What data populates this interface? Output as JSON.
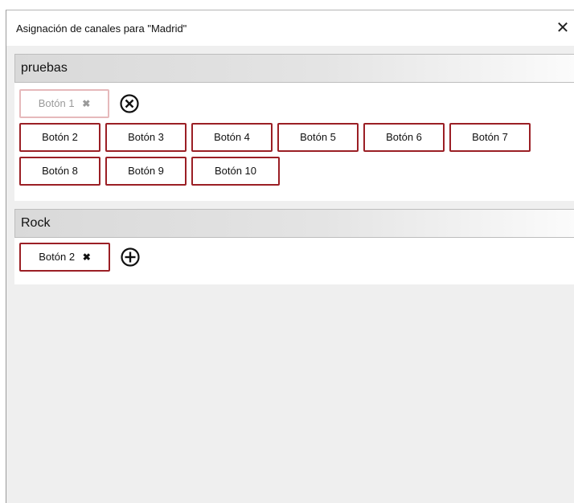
{
  "window": {
    "title": "Asignación de canales para \"Madrid\"",
    "close_label": "✕"
  },
  "groups": [
    {
      "name": "pruebas",
      "selected": [
        {
          "label": "Botón 1",
          "remove_label": "✖",
          "state": "disabled"
        }
      ],
      "action_icon": "circle-x-icon",
      "options": [
        "Botón 2",
        "Botón 3",
        "Botón 4",
        "Botón 5",
        "Botón 6",
        "Botón 7",
        "Botón 8",
        "Botón 9",
        "Botón 10"
      ]
    },
    {
      "name": "Rock",
      "selected": [
        {
          "label": "Botón 2",
          "remove_label": "✖",
          "state": "active"
        }
      ],
      "action_icon": "circle-plus-icon"
    }
  ]
}
